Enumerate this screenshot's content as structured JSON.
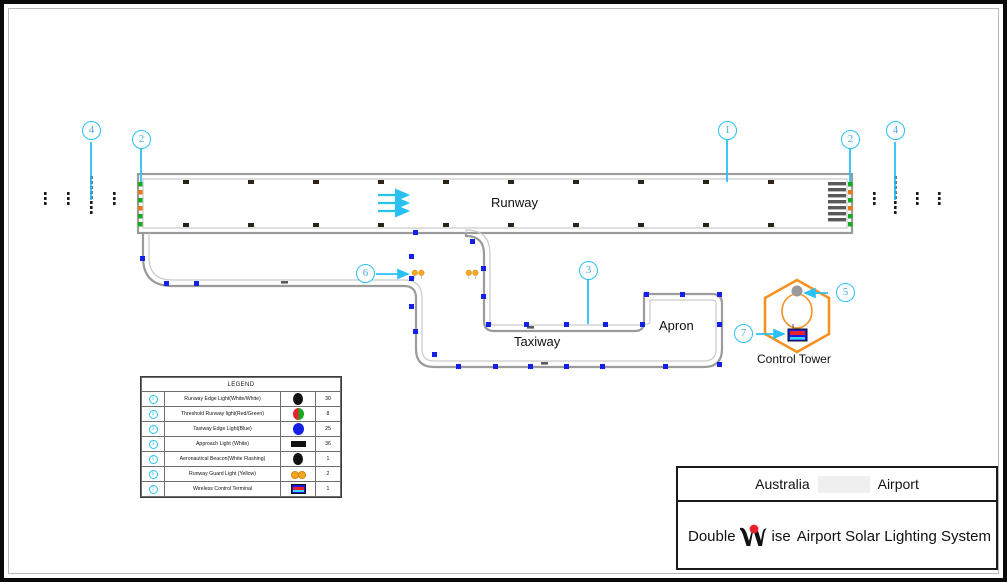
{
  "drawing": {
    "labels": {
      "runway": "Runway",
      "taxiway": "Taxiway",
      "apron": "Apron",
      "control_tower": "Control Tower"
    },
    "callouts": [
      {
        "id": "1",
        "target": "runway-edge-light"
      },
      {
        "id": "2",
        "target": "threshold-runway-light-left"
      },
      {
        "id": "2b",
        "label": "2",
        "target": "threshold-runway-light-right"
      },
      {
        "id": "3",
        "target": "taxiway-edge-light"
      },
      {
        "id": "4",
        "label": "4",
        "target": "approach-light-left"
      },
      {
        "id": "4b",
        "label": "4",
        "target": "approach-light-right"
      },
      {
        "id": "5",
        "target": "aeronautical-beacon"
      },
      {
        "id": "6",
        "target": "runway-guard-light"
      },
      {
        "id": "7",
        "target": "wireless-control-terminal"
      }
    ]
  },
  "legend": {
    "title": "LEGEND",
    "rows": [
      {
        "num": "1",
        "description": "Runway Edge Light(White/White)",
        "symbol": "white-white-lamp",
        "qty": "30"
      },
      {
        "num": "2",
        "description": "Threshold Runway light(Red/Green)",
        "symbol": "red-green-lamp",
        "qty": "8"
      },
      {
        "num": "3",
        "description": "Taxiway Edge Light(Blue)",
        "symbol": "blue-lamp",
        "qty": "25"
      },
      {
        "num": "4",
        "description": "Approach Light (White)",
        "symbol": "approach-bar",
        "qty": "36"
      },
      {
        "num": "5",
        "description": "Aeronautical Beacon(White Flashing)",
        "symbol": "beacon-lamp",
        "qty": "1"
      },
      {
        "num": "6",
        "description": "Runway Guard Light (Yellow)",
        "symbol": "guard-light-pair",
        "qty": "2"
      },
      {
        "num": "7",
        "description": "Wireless Control Terminal",
        "symbol": "terminal-box",
        "qty": "1"
      }
    ]
  },
  "title_block": {
    "project_prefix": "Australia",
    "project_suffix": "Airport",
    "company_part1": "Double",
    "company_part2": "ise",
    "system_title": "Airport Solar Lighting System"
  },
  "colors": {
    "callout_blue": "#29c1f2",
    "taxiway_light_blue": "#1321e8",
    "guard_light_orange": "#f5a623",
    "threshold_green": "#18a824",
    "threshold_red": "#e8212a",
    "tower_orange": "#f59123",
    "logo_red": "#e8212a"
  }
}
